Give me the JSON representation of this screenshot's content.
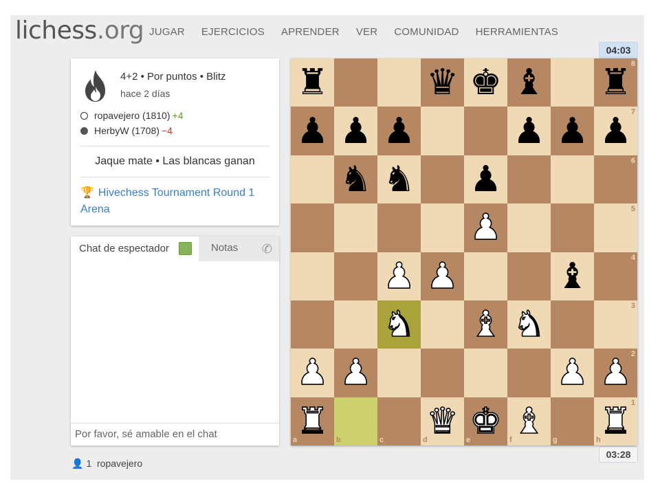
{
  "header": {
    "logo_main": "lichess",
    "logo_tld": ".org",
    "nav": [
      "JUGAR",
      "EJERCICIOS",
      "APRENDER",
      "VER",
      "COMUNIDAD",
      "HERRAMIENTAS"
    ]
  },
  "clocks": {
    "top": "04:03",
    "bottom": "03:28"
  },
  "game": {
    "icon": "flame-icon",
    "type": "4+2 • Por puntos • Blitz",
    "date": "hace 2 días",
    "white_player": "ropavejero (1810)",
    "white_diff": "+4",
    "black_player": "HerbyW (1708)",
    "black_diff": "−4",
    "status": "Jaque mate • Las blancas ganan",
    "tournament": "Hivechess Tournament Round 1 Arena"
  },
  "chat": {
    "tab_chat": "Chat de espectador",
    "tab_notes": "Notas",
    "placeholder": "Por favor, sé amable en el chat"
  },
  "spectators": {
    "count": "1",
    "name": "ropavejero"
  },
  "board": {
    "ranks": [
      "8",
      "7",
      "6",
      "5",
      "4",
      "3",
      "2",
      "1"
    ],
    "files": [
      "a",
      "b",
      "c",
      "d",
      "e",
      "f",
      "g",
      "h"
    ],
    "highlighted": [
      "c3",
      "b1"
    ],
    "rows": [
      [
        "bR",
        "",
        "",
        "bQ",
        "bK",
        "bB",
        "",
        "bR"
      ],
      [
        "bP",
        "bP",
        "bP",
        "",
        "",
        "bP",
        "bP",
        "bP"
      ],
      [
        "",
        "bN",
        "bN",
        "",
        "bP",
        "",
        "",
        ""
      ],
      [
        "",
        "",
        "",
        "",
        "wP",
        "",
        "",
        ""
      ],
      [
        "",
        "",
        "wP",
        "wP",
        "",
        "",
        "bB",
        ""
      ],
      [
        "",
        "",
        "wN",
        "",
        "wB",
        "wN",
        "",
        ""
      ],
      [
        "wP",
        "wP",
        "",
        "",
        "",
        "",
        "wP",
        "wP"
      ],
      [
        "wR",
        "",
        "",
        "wQ",
        "wK",
        "wB",
        "",
        "wR"
      ]
    ]
  },
  "colors": {
    "light_square": "#f0d9b5",
    "dark_square": "#b58863",
    "highlight": "#cdd16e",
    "link": "#3a7ec2"
  }
}
